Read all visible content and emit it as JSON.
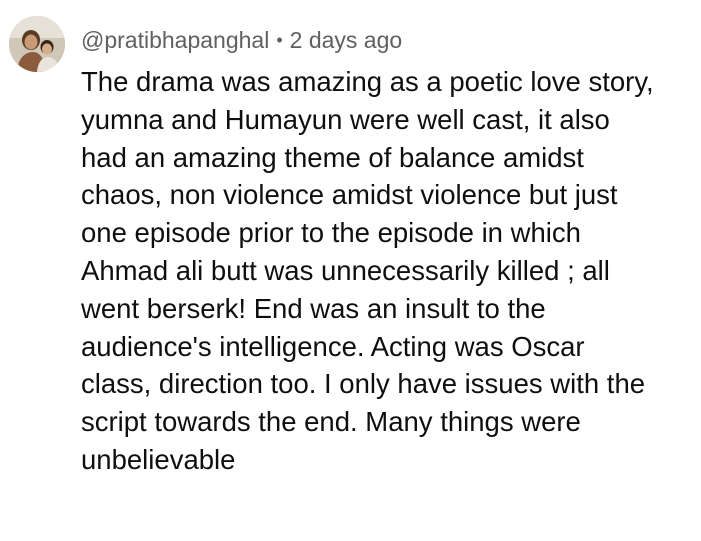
{
  "comment": {
    "author_handle": "@pratibhapanghal",
    "separator": "•",
    "timestamp": "2 days ago",
    "avatar_icon": "user-avatar",
    "lines": [
      "The drama was amazing as a poetic love story,",
      "yumna and Humayun were well cast, it also",
      "had an amazing theme of balance amidst",
      "chaos, non violence amidst violence but just",
      "one episode prior to the episode in which",
      "Ahmad ali butt was unnecessarily killed ; all",
      "went berserk! End was an insult to the",
      "audience's intelligence. Acting was Oscar",
      "class, direction too. I only have issues with the",
      "script towards the end. Many things were",
      "unbelievable"
    ]
  },
  "colors": {
    "text_primary": "#0f0f0f",
    "text_secondary": "#606060",
    "background": "#ffffff"
  }
}
